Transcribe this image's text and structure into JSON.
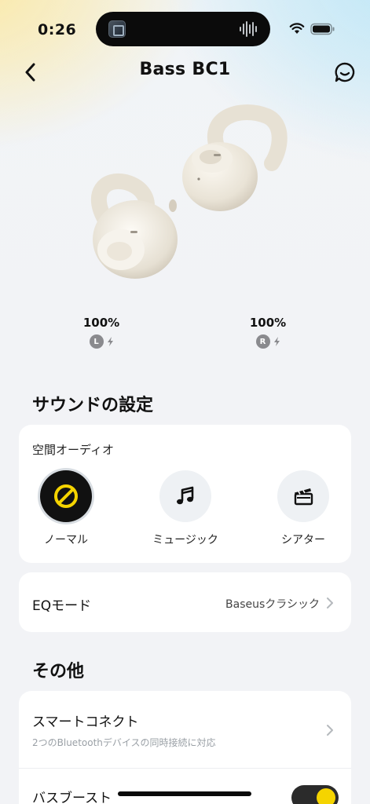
{
  "status_bar": {
    "time": "0:26"
  },
  "header": {
    "title": "Bass BC1"
  },
  "battery": {
    "left": {
      "percent": "100%",
      "side": "L",
      "charging": true
    },
    "right": {
      "percent": "100%",
      "side": "R",
      "charging": true
    }
  },
  "sound_settings": {
    "section_title": "サウンドの設定",
    "spatial_audio": {
      "title": "空間オーディオ",
      "modes": [
        {
          "label": "ノーマル",
          "icon": "disabled-icon",
          "selected": true
        },
        {
          "label": "ミュージック",
          "icon": "music-note-icon",
          "selected": false
        },
        {
          "label": "シアター",
          "icon": "clapperboard-icon",
          "selected": false
        }
      ]
    },
    "eq": {
      "label": "EQモード",
      "value": "Baseusクラシック"
    }
  },
  "other": {
    "section_title": "その他",
    "smart_connect": {
      "label": "スマートコネクト",
      "description": "2つのBluetoothデバイスの同時接続に対応"
    },
    "bass_boost": {
      "label": "バスブースト",
      "enabled": true
    }
  },
  "colors": {
    "accent_yellow": "#f5d400",
    "dark": "#111111",
    "card": "#ffffff",
    "background": "#f2f3f6"
  }
}
